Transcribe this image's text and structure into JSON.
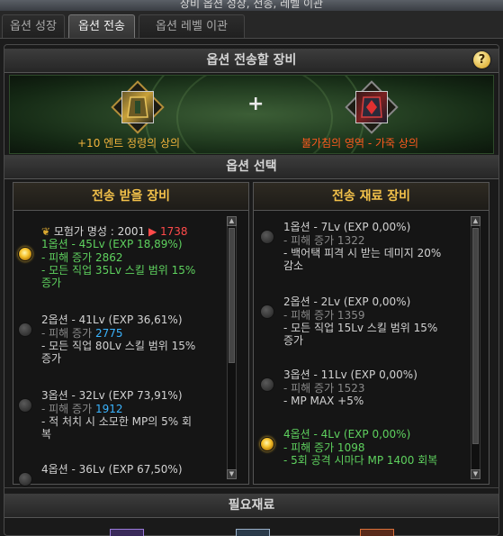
{
  "window": {
    "title": "장비 옵션 성장, 전송, 레벨 이관"
  },
  "tabs": [
    "옵션 성장",
    "옵션 전송",
    "옵션 레벨 이관"
  ],
  "active_tab": "옵션 전송",
  "transfer_section": {
    "title": "옵션 전송할 장비",
    "help": "?"
  },
  "source_item": {
    "name": "+10 엔트 정령의 상의",
    "color": "#f0b23c"
  },
  "target_item": {
    "name": "불가침의 영역 - 가죽 상의",
    "color": "#ff5a1e"
  },
  "plus_sign": "+",
  "option_section": {
    "title": "옵션 선택"
  },
  "receive_panel": {
    "title": "전송 받을 장비",
    "rank_label": "모험가 명성 : 2001",
    "rank_arrow": "▶",
    "rank_value": "1738",
    "options": [
      {
        "head": "1옵션 - 45Lv (EXP 18,89%)",
        "selected": true,
        "head_color": "#5ed15e",
        "lines": [
          {
            "prefix": "- 피해 증가 ",
            "value": "2862",
            "value_blue": false
          },
          {
            "prefix": "- 모든 직업 35Lv 스킬 범위 15%",
            "value": ""
          },
          {
            "prefix": "  증가",
            "value": ""
          }
        ]
      },
      {
        "head": "2옵션 - 41Lv (EXP 36,61%)",
        "selected": false,
        "head_color": "#d2d2d2",
        "lines": [
          {
            "prefix": "- 피해 증가 ",
            "value": "2775",
            "value_blue": true
          },
          {
            "prefix": "- 모든 직업 80Lv 스킬 범위 15%",
            "value": ""
          },
          {
            "prefix": "  증가",
            "value": ""
          }
        ]
      },
      {
        "head": "3옵션 - 32Lv (EXP 73,91%)",
        "selected": false,
        "head_color": "#d2d2d2",
        "lines": [
          {
            "prefix": "- 피해 증가 ",
            "value": "1912",
            "value_blue": true
          },
          {
            "prefix": "- 적 처치 시 소모한 MP의 5% 회",
            "value": ""
          },
          {
            "prefix": "  복",
            "value": ""
          }
        ]
      },
      {
        "head": "4옵션 - 36Lv (EXP 67,50%)",
        "selected": false,
        "head_color": "#d2d2d2",
        "lines": []
      }
    ]
  },
  "material_panel": {
    "title": "전송 재료 장비",
    "options": [
      {
        "head": "1옵션 - 7Lv (EXP 0,00%)",
        "selected": false,
        "head_color": "#d2d2d2",
        "lines": [
          {
            "prefix": "- 피해 증가 1322"
          },
          {
            "prefix": "- 백어택 피격 시 받는 데미지 20%"
          },
          {
            "prefix": "  감소"
          }
        ]
      },
      {
        "head": "2옵션 - 2Lv (EXP 0,00%)",
        "selected": false,
        "head_color": "#d2d2d2",
        "lines": [
          {
            "prefix": "- 피해 증가 1359"
          },
          {
            "prefix": "- 모든 직업 15Lv 스킬 범위 15%"
          },
          {
            "prefix": "  증가"
          }
        ]
      },
      {
        "head": "3옵션 - 11Lv (EXP 0,00%)",
        "selected": false,
        "head_color": "#d2d2d2",
        "lines": [
          {
            "prefix": "- 피해 증가 1523"
          },
          {
            "prefix": "- MP MAX +5%"
          }
        ]
      },
      {
        "head": "4옵션 - 4Lv (EXP 0,00%)",
        "selected": true,
        "head_color": "#5ed15e",
        "lines": [
          {
            "prefix": "- 피해 증가 1098"
          },
          {
            "prefix": "- 5회 공격 시마다 MP 1400 회복"
          }
        ]
      }
    ]
  },
  "required_section": {
    "title": "필요재료"
  }
}
